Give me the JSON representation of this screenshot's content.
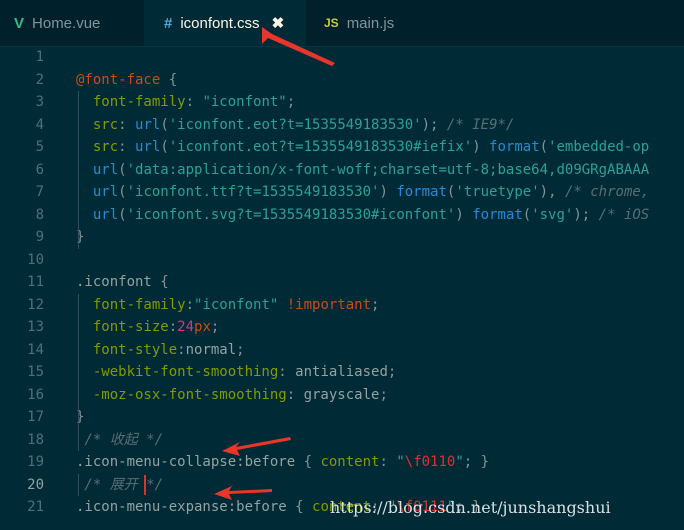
{
  "tabs": [
    {
      "icon": "V",
      "label": "Home.vue",
      "active": false
    },
    {
      "icon": "#",
      "label": "iconfont.css",
      "active": true,
      "close": "✖"
    },
    {
      "icon": "JS",
      "label": "main.js",
      "active": false
    }
  ],
  "lines": [
    {
      "n": "1",
      "tokens": [
        {
          "t": "",
          "c": "txt"
        }
      ]
    },
    {
      "n": "2",
      "tokens": [
        {
          "t": "@font-face",
          "c": "at"
        },
        {
          "t": " {",
          "c": "brace"
        }
      ]
    },
    {
      "n": "3",
      "tokens": [
        {
          "t": "  font-family",
          "c": "prop"
        },
        {
          "t": ": ",
          "c": "txt"
        },
        {
          "t": "\"iconfont\"",
          "c": "str"
        },
        {
          "t": ";",
          "c": "txt"
        }
      ]
    },
    {
      "n": "4",
      "tokens": [
        {
          "t": "  src",
          "c": "prop"
        },
        {
          "t": ": ",
          "c": "txt"
        },
        {
          "t": "url",
          "c": "fn"
        },
        {
          "t": "(",
          "c": "txt"
        },
        {
          "t": "'iconfont.eot?t=1535549183530'",
          "c": "str"
        },
        {
          "t": "); ",
          "c": "txt"
        },
        {
          "t": "/* IE9*/",
          "c": "com"
        }
      ]
    },
    {
      "n": "5",
      "tokens": [
        {
          "t": "  src",
          "c": "prop"
        },
        {
          "t": ": ",
          "c": "txt"
        },
        {
          "t": "url",
          "c": "fn"
        },
        {
          "t": "(",
          "c": "txt"
        },
        {
          "t": "'iconfont.eot?t=1535549183530#iefix'",
          "c": "str"
        },
        {
          "t": ") ",
          "c": "txt"
        },
        {
          "t": "format",
          "c": "fn"
        },
        {
          "t": "(",
          "c": "txt"
        },
        {
          "t": "'embedded-op",
          "c": "str"
        }
      ]
    },
    {
      "n": "6",
      "tokens": [
        {
          "t": "  url",
          "c": "fn"
        },
        {
          "t": "(",
          "c": "txt"
        },
        {
          "t": "'data:application/x-font-woff;charset=utf-8;base64,d09GRgABAAA",
          "c": "str"
        }
      ]
    },
    {
      "n": "7",
      "tokens": [
        {
          "t": "  url",
          "c": "fn"
        },
        {
          "t": "(",
          "c": "txt"
        },
        {
          "t": "'iconfont.ttf?t=1535549183530'",
          "c": "str"
        },
        {
          "t": ") ",
          "c": "txt"
        },
        {
          "t": "format",
          "c": "fn"
        },
        {
          "t": "(",
          "c": "txt"
        },
        {
          "t": "'truetype'",
          "c": "str"
        },
        {
          "t": "), ",
          "c": "txt"
        },
        {
          "t": "/* chrome,",
          "c": "com"
        }
      ]
    },
    {
      "n": "8",
      "tokens": [
        {
          "t": "  url",
          "c": "fn"
        },
        {
          "t": "(",
          "c": "txt"
        },
        {
          "t": "'iconfont.svg?t=1535549183530#iconfont'",
          "c": "str"
        },
        {
          "t": ") ",
          "c": "txt"
        },
        {
          "t": "format",
          "c": "fn"
        },
        {
          "t": "(",
          "c": "txt"
        },
        {
          "t": "'svg'",
          "c": "str"
        },
        {
          "t": "); ",
          "c": "txt"
        },
        {
          "t": "/* iOS",
          "c": "com"
        }
      ]
    },
    {
      "n": "9",
      "tokens": [
        {
          "t": "}",
          "c": "brace"
        }
      ]
    },
    {
      "n": "10",
      "tokens": [
        {
          "t": "",
          "c": "txt"
        }
      ]
    },
    {
      "n": "11",
      "tokens": [
        {
          "t": ".iconfont",
          "c": "sel"
        },
        {
          "t": " {",
          "c": "brace"
        }
      ]
    },
    {
      "n": "12",
      "tokens": [
        {
          "t": "  font-family",
          "c": "prop"
        },
        {
          "t": ":",
          "c": "txt"
        },
        {
          "t": "\"iconfont\"",
          "c": "str"
        },
        {
          "t": " ",
          "c": "txt"
        },
        {
          "t": "!important",
          "c": "kw"
        },
        {
          "t": ";",
          "c": "txt"
        }
      ]
    },
    {
      "n": "13",
      "tokens": [
        {
          "t": "  font-size",
          "c": "prop"
        },
        {
          "t": ":",
          "c": "txt"
        },
        {
          "t": "24",
          "c": "num"
        },
        {
          "t": "px",
          "c": "kw"
        },
        {
          "t": ";",
          "c": "txt"
        }
      ]
    },
    {
      "n": "14",
      "tokens": [
        {
          "t": "  font-style",
          "c": "prop"
        },
        {
          "t": ":",
          "c": "txt"
        },
        {
          "t": "normal",
          "c": "val"
        },
        {
          "t": ";",
          "c": "txt"
        }
      ]
    },
    {
      "n": "15",
      "tokens": [
        {
          "t": "  -webkit-font-smoothing",
          "c": "prop"
        },
        {
          "t": ": ",
          "c": "txt"
        },
        {
          "t": "antialiased",
          "c": "val"
        },
        {
          "t": ";",
          "c": "txt"
        }
      ]
    },
    {
      "n": "16",
      "tokens": [
        {
          "t": "  -moz-osx-font-smoothing",
          "c": "prop"
        },
        {
          "t": ": ",
          "c": "txt"
        },
        {
          "t": "grayscale",
          "c": "val"
        },
        {
          "t": ";",
          "c": "txt"
        }
      ]
    },
    {
      "n": "17",
      "tokens": [
        {
          "t": "}",
          "c": "brace"
        }
      ]
    },
    {
      "n": "18",
      "tokens": [
        {
          "t": " /* 收起 */",
          "c": "com"
        }
      ]
    },
    {
      "n": "19",
      "tokens": [
        {
          "t": ".icon-menu-collapse:before",
          "c": "sel"
        },
        {
          "t": " { ",
          "c": "brace"
        },
        {
          "t": "content",
          "c": "prop"
        },
        {
          "t": ": ",
          "c": "txt"
        },
        {
          "t": "\"",
          "c": "str"
        },
        {
          "t": "\\f0110",
          "c": "esc"
        },
        {
          "t": "\"",
          "c": "str"
        },
        {
          "t": "; }",
          "c": "brace"
        }
      ]
    },
    {
      "n": "20",
      "tokens": [
        {
          "t": " /* 展开 */",
          "c": "com"
        }
      ]
    },
    {
      "n": "21",
      "tokens": [
        {
          "t": ".icon-menu-expanse:before",
          "c": "sel"
        },
        {
          "t": " { ",
          "c": "brace"
        },
        {
          "t": "content",
          "c": "prop"
        },
        {
          "t": ": ",
          "c": "txt"
        },
        {
          "t": "\"",
          "c": "str"
        },
        {
          "t": "\\f0111",
          "c": "esc"
        },
        {
          "t": "\"",
          "c": "str"
        },
        {
          "t": "; }",
          "c": "brace"
        }
      ]
    }
  ],
  "watermark": "https://blog.csdn.net/junshangshui",
  "colors": {
    "background": "#002b36",
    "tabbar": "#00212b",
    "arrow": "#e8362b"
  }
}
